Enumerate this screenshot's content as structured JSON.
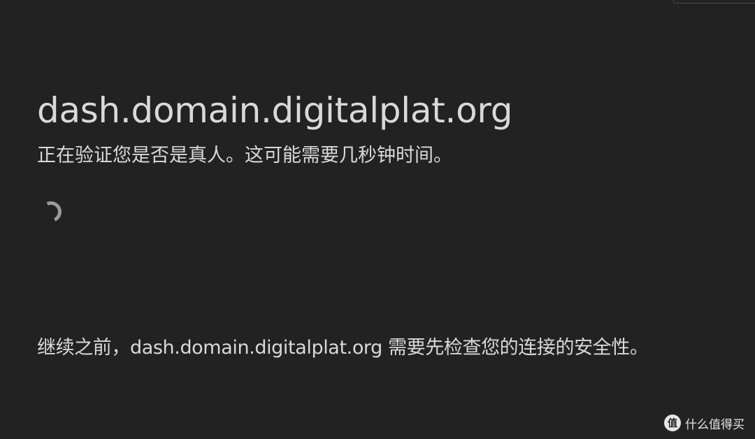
{
  "page": {
    "site_title": "dash.domain.digitalplat.org",
    "verify_message": "正在验证您是否是真人。这可能需要几秒钟时间。",
    "notice_message": "继续之前，dash.domain.digitalplat.org 需要先检查您的连接的安全性。"
  },
  "watermark": {
    "logo_glyph": "值",
    "text": "什么值得买"
  },
  "colors": {
    "background": "#222222",
    "text": "#d9d9d9",
    "spinner": "#9a9a9a"
  },
  "icons": {
    "spinner": "loading-spinner-icon",
    "watermark_logo": "smzdm-logo-icon"
  }
}
